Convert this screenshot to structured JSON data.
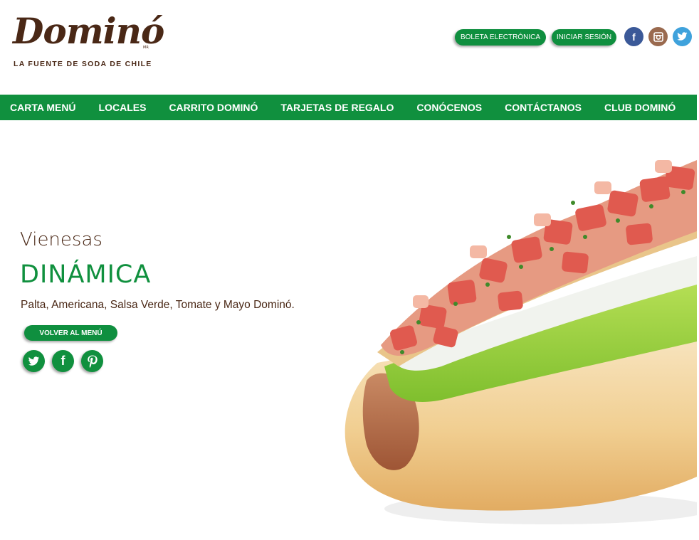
{
  "brand": {
    "name": "Dominó",
    "mark": "MR",
    "tagline": "LA FUENTE DE SODA DE CHILE",
    "color": "#4a2816"
  },
  "header": {
    "boleta_label": "BOLETA ELECTRÓNICA",
    "login_label": "INICIAR SESIÓN",
    "social": [
      {
        "icon": "facebook-icon",
        "glyph": "f"
      },
      {
        "icon": "instagram-icon",
        "glyph": "◙"
      },
      {
        "icon": "twitter-icon",
        "glyph": "🐦"
      }
    ]
  },
  "nav": {
    "items": [
      {
        "label": "CARTA MENÚ"
      },
      {
        "label": "LOCALES"
      },
      {
        "label": "CARRITO DOMINÓ"
      },
      {
        "label": "TARJETAS DE REGALO"
      },
      {
        "label": "CONÓCENOS"
      },
      {
        "label": "CONTÁCTANOS"
      },
      {
        "label": "CLUB DOMINÓ"
      }
    ],
    "color": "#10903e"
  },
  "product": {
    "category": "Vienesas",
    "name": "DINÁMICA",
    "description": "Palta, Americana, Salsa Verde, Tomate y Mayo Dominó.",
    "back_label": "VOLVER AL MENÚ",
    "share": [
      {
        "icon": "twitter-icon",
        "glyph": "🐦"
      },
      {
        "icon": "facebook-icon",
        "glyph": "f"
      },
      {
        "icon": "pinterest-icon",
        "glyph": "P"
      }
    ],
    "image": "hot-dog-photo"
  }
}
